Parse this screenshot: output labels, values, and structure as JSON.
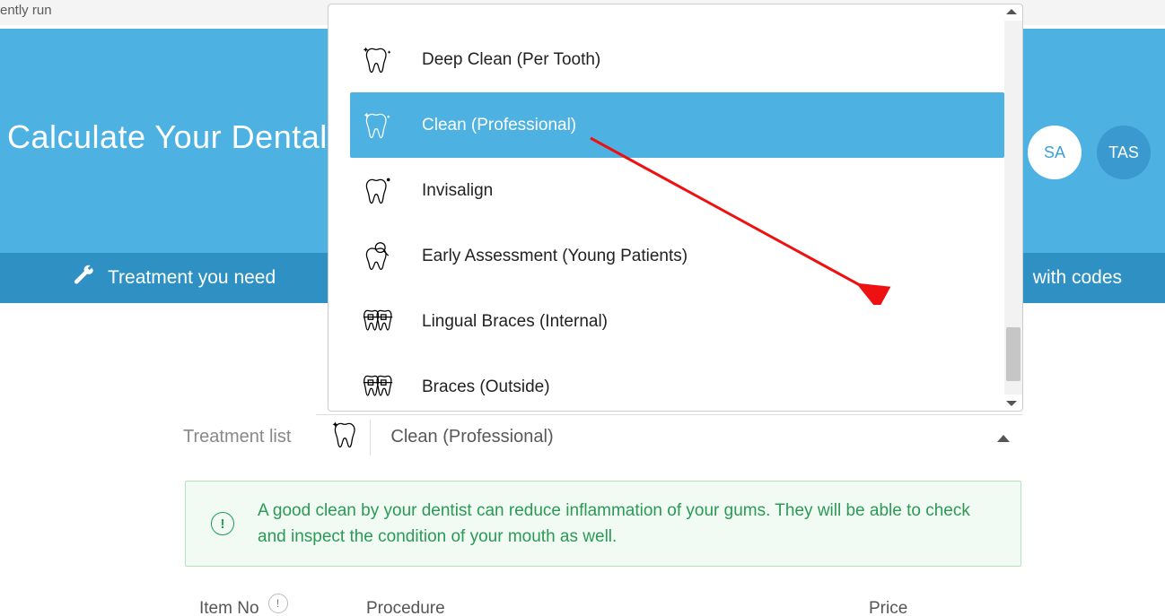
{
  "top_snippet": "ently run",
  "hero": {
    "title": "Calculate Your Dental Cos"
  },
  "state_pills": {
    "sa": "SA",
    "tas": "TAS"
  },
  "subnav": {
    "left": "Treatment you need",
    "right": "with codes"
  },
  "dropdown": {
    "items": [
      {
        "label": "Deep Clean (Per Tooth)",
        "selected": false,
        "icon": "tooth-sparkle"
      },
      {
        "label": "Clean (Professional)",
        "selected": true,
        "icon": "tooth-sparkle"
      },
      {
        "label": "Invisalign",
        "selected": false,
        "icon": "tooth-dot"
      },
      {
        "label": "Early Assessment (Young Patients)",
        "selected": false,
        "icon": "tooth-magnify"
      },
      {
        "label": "Lingual Braces (Internal)",
        "selected": false,
        "icon": "braces"
      },
      {
        "label": "Braces (Outside)",
        "selected": false,
        "icon": "braces"
      }
    ]
  },
  "treatment_row": {
    "label": "Treatment list",
    "selected_value": "Clean (Professional)"
  },
  "info_text": "A good clean by your dentist can reduce inflammation of your gums. They will be able to check and inspect the condition of your mouth as well.",
  "table_header": {
    "item_no": "Item No",
    "procedure": "Procedure",
    "price": "Price"
  }
}
